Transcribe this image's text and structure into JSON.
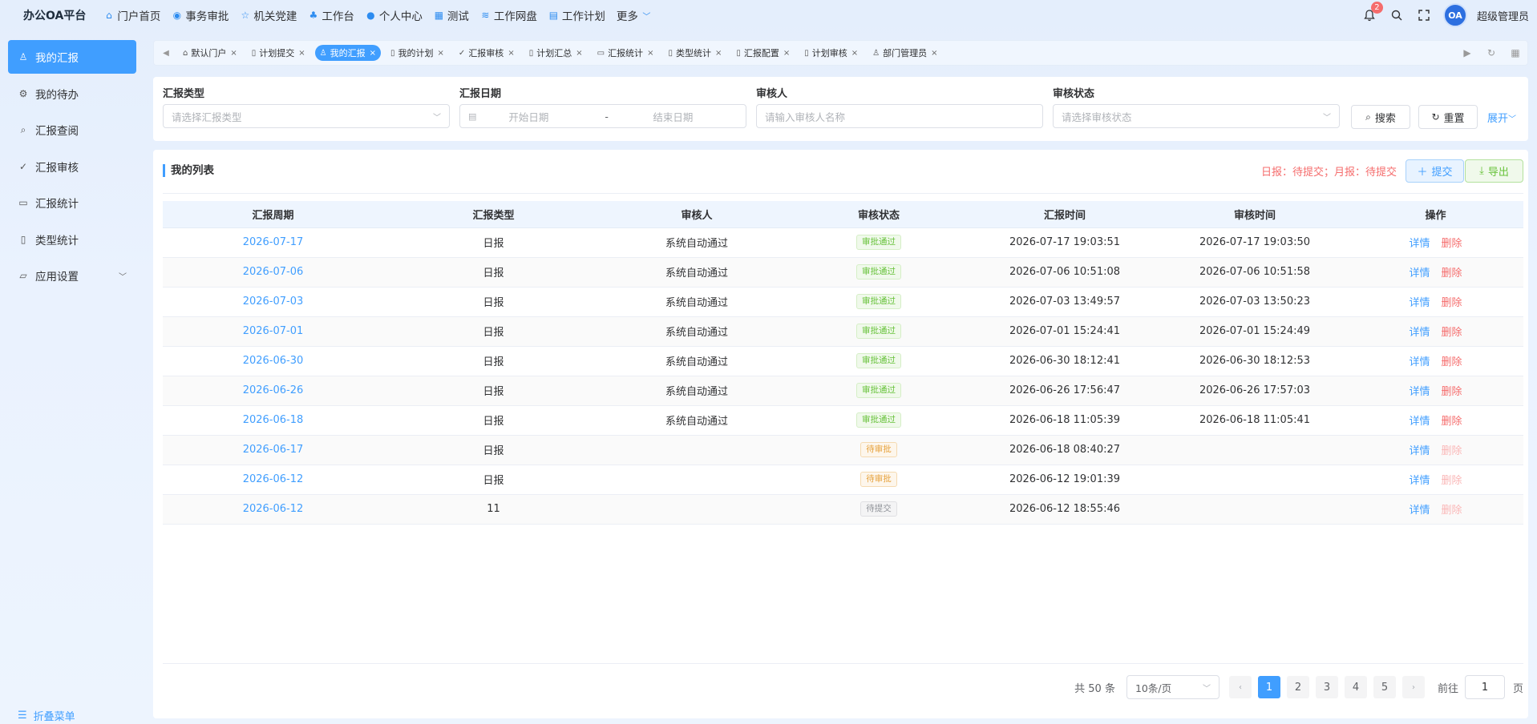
{
  "brand": "办公OA平台",
  "topnav": [
    {
      "icon": "home-icon",
      "glyph": "⌂",
      "label": "门户首页"
    },
    {
      "icon": "approval-icon",
      "glyph": "◉",
      "label": "事务审批"
    },
    {
      "icon": "star-icon",
      "glyph": "☆",
      "label": "机关党建"
    },
    {
      "icon": "workbench-icon",
      "glyph": "♣",
      "label": "工作台"
    },
    {
      "icon": "user-icon",
      "glyph": "●",
      "label": "个人中心"
    },
    {
      "icon": "grid-icon",
      "glyph": "▦",
      "label": "测试"
    },
    {
      "icon": "database-icon",
      "glyph": "≋",
      "label": "工作网盘"
    },
    {
      "icon": "calendar-icon",
      "glyph": "▤",
      "label": "工作计划"
    },
    {
      "icon": "",
      "glyph": "",
      "label": "更多"
    }
  ],
  "header": {
    "notification_count": "2",
    "avatar_text": "OA",
    "username": "超级管理员"
  },
  "sidebar": {
    "items": [
      {
        "icon": "user-icon",
        "glyph": "♙",
        "label": "我的汇报",
        "active": true
      },
      {
        "icon": "gear-icon",
        "glyph": "⚙",
        "label": "我的待办"
      },
      {
        "icon": "search-icon",
        "glyph": "⌕",
        "label": "汇报查阅"
      },
      {
        "icon": "review-icon",
        "glyph": "✓",
        "label": "汇报审核"
      },
      {
        "icon": "chart-icon",
        "glyph": "▭",
        "label": "汇报统计"
      },
      {
        "icon": "document-icon",
        "glyph": "▯",
        "label": "类型统计"
      },
      {
        "icon": "folder-icon",
        "glyph": "▱",
        "label": "应用设置"
      }
    ],
    "collapse_label": "折叠菜单"
  },
  "tabs": [
    {
      "icon": "home-icon",
      "glyph": "⌂",
      "label": "默认门户"
    },
    {
      "icon": "document-icon",
      "glyph": "▯",
      "label": "计划提交"
    },
    {
      "icon": "user-icon",
      "glyph": "♙",
      "label": "我的汇报",
      "active": true
    },
    {
      "icon": "document-icon",
      "glyph": "▯",
      "label": "我的计划"
    },
    {
      "icon": "review-icon",
      "glyph": "✓",
      "label": "汇报审核"
    },
    {
      "icon": "document-icon",
      "glyph": "▯",
      "label": "计划汇总"
    },
    {
      "icon": "chart-icon",
      "glyph": "▭",
      "label": "汇报统计"
    },
    {
      "icon": "document-icon",
      "glyph": "▯",
      "label": "类型统计"
    },
    {
      "icon": "document-icon",
      "glyph": "▯",
      "label": "汇报配置"
    },
    {
      "icon": "document-icon",
      "glyph": "▯",
      "label": "计划审核"
    },
    {
      "icon": "user-icon",
      "glyph": "♙",
      "label": "部门管理员"
    }
  ],
  "filter": {
    "type_label": "汇报类型",
    "type_placeholder": "请选择汇报类型",
    "date_label": "汇报日期",
    "date_start": "开始日期",
    "date_sep": "-",
    "date_end": "结束日期",
    "reviewer_label": "审核人",
    "reviewer_placeholder": "请输入审核人名称",
    "status_label": "审核状态",
    "status_placeholder": "请选择审核状态",
    "search_label": "搜索",
    "reset_label": "重置",
    "expand_label": "展开"
  },
  "list": {
    "title": "我的列表",
    "status_note": "日报：待提交；月报：待提交",
    "submit_label": "提交",
    "export_label": "导出",
    "columns": [
      "汇报周期",
      "汇报类型",
      "审核人",
      "审核状态",
      "汇报时间",
      "审核时间",
      "操作"
    ],
    "detail_label": "详情",
    "delete_label": "删除",
    "rows": [
      {
        "period": "2026-07-17",
        "type": "日报",
        "reviewer": "系统自动通过",
        "status": "审批通过",
        "status_kind": "ok",
        "report_time": "2026-07-17 19:03:51",
        "review_time": "2026-07-17 19:03:50",
        "deletable": true
      },
      {
        "period": "2026-07-06",
        "type": "日报",
        "reviewer": "系统自动通过",
        "status": "审批通过",
        "status_kind": "ok",
        "report_time": "2026-07-06 10:51:08",
        "review_time": "2026-07-06 10:51:58",
        "deletable": true
      },
      {
        "period": "2026-07-03",
        "type": "日报",
        "reviewer": "系统自动通过",
        "status": "审批通过",
        "status_kind": "ok",
        "report_time": "2026-07-03 13:49:57",
        "review_time": "2026-07-03 13:50:23",
        "deletable": true
      },
      {
        "period": "2026-07-01",
        "type": "日报",
        "reviewer": "系统自动通过",
        "status": "审批通过",
        "status_kind": "ok",
        "report_time": "2026-07-01 15:24:41",
        "review_time": "2026-07-01 15:24:49",
        "deletable": true
      },
      {
        "period": "2026-06-30",
        "type": "日报",
        "reviewer": "系统自动通过",
        "status": "审批通过",
        "status_kind": "ok",
        "report_time": "2026-06-30 18:12:41",
        "review_time": "2026-06-30 18:12:53",
        "deletable": true
      },
      {
        "period": "2026-06-26",
        "type": "日报",
        "reviewer": "系统自动通过",
        "status": "审批通过",
        "status_kind": "ok",
        "report_time": "2026-06-26 17:56:47",
        "review_time": "2026-06-26 17:57:03",
        "deletable": true
      },
      {
        "period": "2026-06-18",
        "type": "日报",
        "reviewer": "系统自动通过",
        "status": "审批通过",
        "status_kind": "ok",
        "report_time": "2026-06-18 11:05:39",
        "review_time": "2026-06-18 11:05:41",
        "deletable": true
      },
      {
        "period": "2026-06-17",
        "type": "日报",
        "reviewer": "",
        "status": "待审批",
        "status_kind": "pending",
        "report_time": "2026-06-18 08:40:27",
        "review_time": "",
        "deletable": false
      },
      {
        "period": "2026-06-12",
        "type": "日报",
        "reviewer": "",
        "status": "待审批",
        "status_kind": "pending",
        "report_time": "2026-06-12 19:01:39",
        "review_time": "",
        "deletable": false
      },
      {
        "period": "2026-06-12",
        "type": "11",
        "reviewer": "",
        "status": "待提交",
        "status_kind": "draft",
        "report_time": "2026-06-12 18:55:46",
        "review_time": "",
        "deletable": false
      }
    ]
  },
  "pagination": {
    "total": "共 50 条",
    "page_size": "10条/页",
    "pages": [
      "1",
      "2",
      "3",
      "4",
      "5"
    ],
    "current": "1",
    "goto_label": "前往",
    "goto_value": "1",
    "page_suffix": "页"
  },
  "colors": {
    "accent": "#409eff",
    "success": "#67c23a",
    "warning": "#e6a23c",
    "danger": "#f56c6c"
  }
}
